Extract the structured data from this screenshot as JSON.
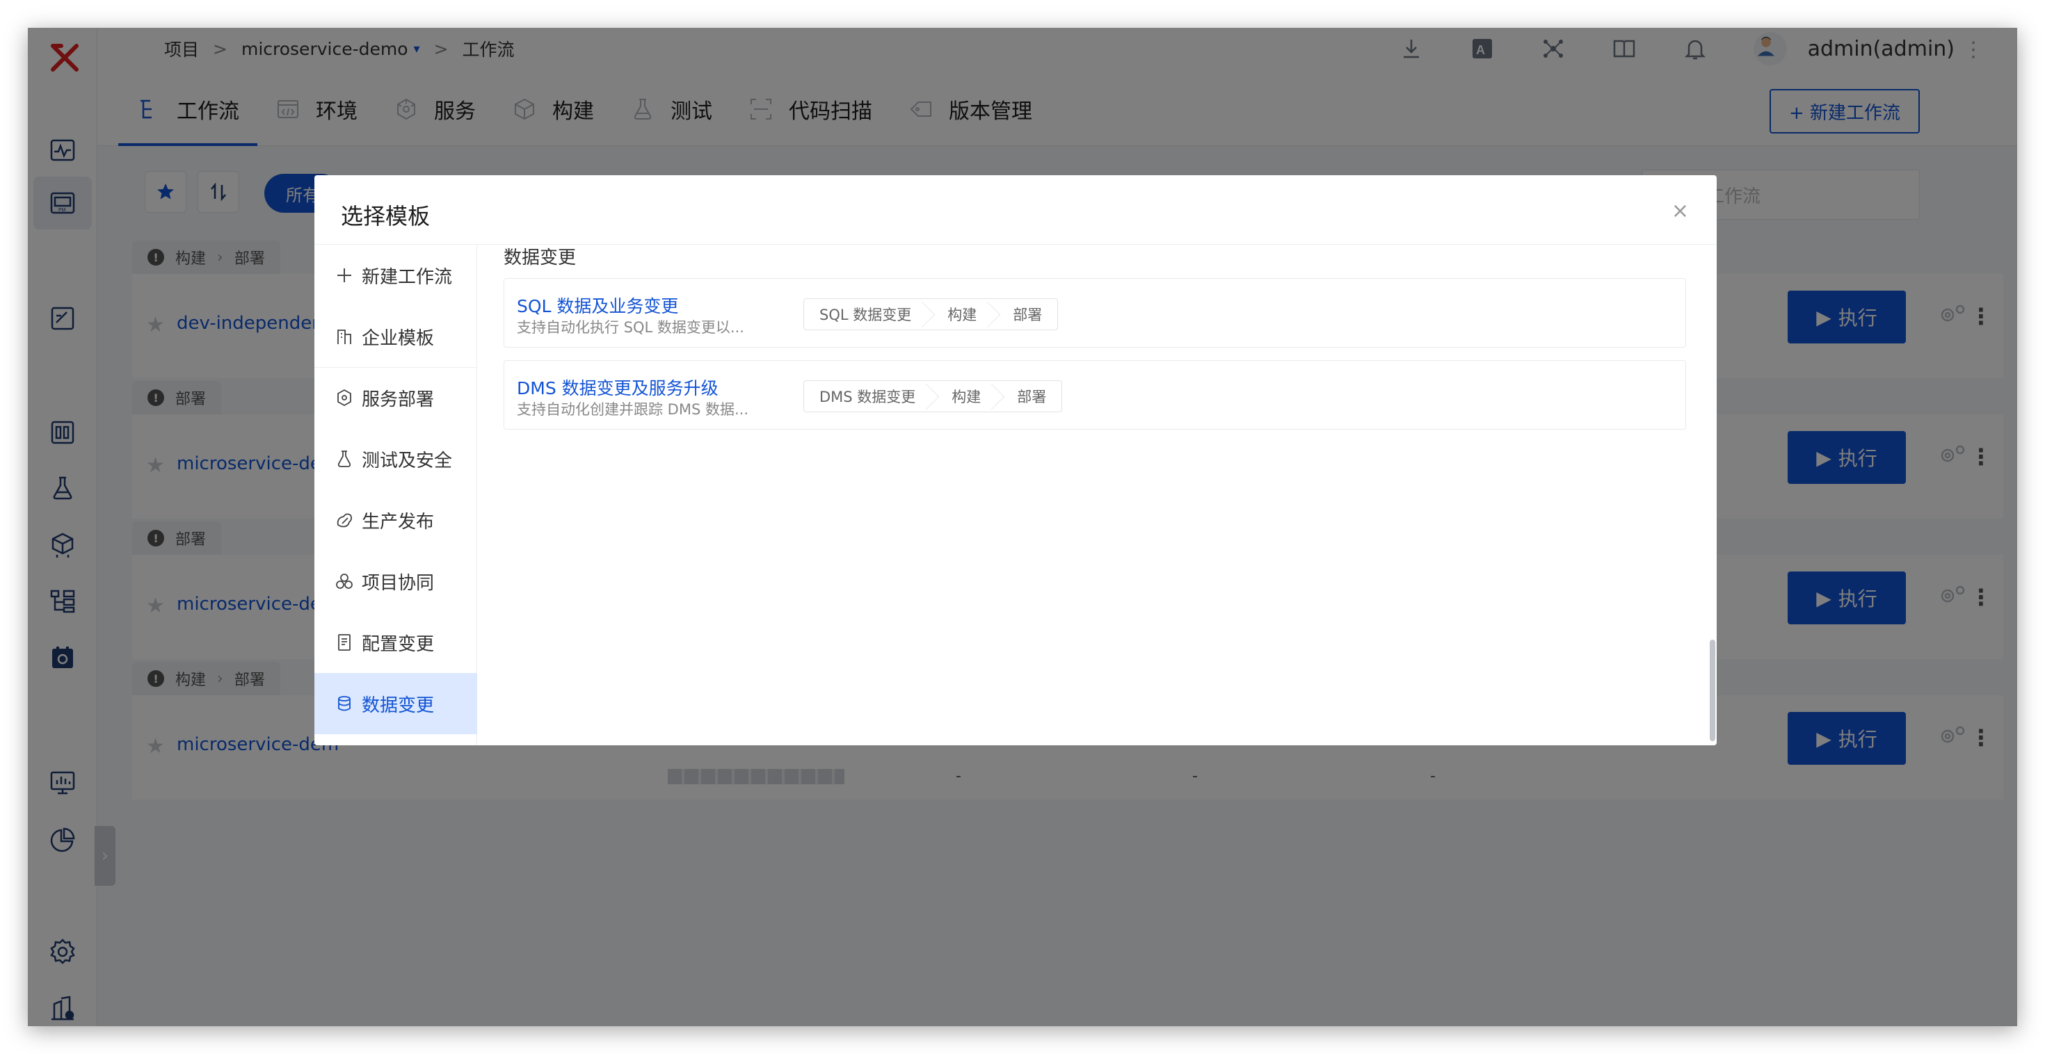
{
  "header": {
    "breadcrumb": {
      "root": "项目",
      "sep1": ">",
      "project": "microservice-demo",
      "caret": "▾",
      "sep2": ">",
      "page": "工作流"
    },
    "icons": [
      "download-icon",
      "translate-icon",
      "network-icon",
      "docs-icon",
      "bell-icon"
    ],
    "user": {
      "name": "admin(admin)"
    },
    "more": "⋮"
  },
  "tabs": [
    {
      "label": "工作流",
      "icon": "workflow-icon"
    },
    {
      "label": "环境",
      "icon": "environment-icon"
    },
    {
      "label": "服务",
      "icon": "service-icon"
    },
    {
      "label": "构建",
      "icon": "build-icon"
    },
    {
      "label": "测试",
      "icon": "test-icon"
    },
    {
      "label": "代码扫描",
      "icon": "scan-icon"
    },
    {
      "label": "版本管理",
      "icon": "version-icon"
    }
  ],
  "actions": {
    "new_workflow": "+ 新建工作流"
  },
  "filters": {
    "all": "所有",
    "search_placeholder": "搜索工作流"
  },
  "workflows": [
    {
      "tags": [
        "构建",
        "部署"
      ],
      "name": "dev-independent-",
      "exec": "执行"
    },
    {
      "tags": [
        "部署"
      ],
      "name": "microservice-dem",
      "exec": "执行"
    },
    {
      "tags": [
        "部署"
      ],
      "name": "microservice-dem",
      "exec": "执行"
    },
    {
      "tags": [
        "构建",
        "部署"
      ],
      "name": "microservice-dem",
      "exec": "执行",
      "cells": [
        "-",
        "-",
        "-"
      ]
    }
  ],
  "modal": {
    "title": "选择模板",
    "close": "×",
    "nav": [
      {
        "label": "新建工作流",
        "icon": "plus-icon"
      },
      {
        "label": "企业模板",
        "icon": "enterprise-icon"
      },
      {
        "label": "服务部署",
        "icon": "deploy-icon"
      },
      {
        "label": "测试及安全",
        "icon": "security-icon"
      },
      {
        "label": "生产发布",
        "icon": "release-icon"
      },
      {
        "label": "项目协同",
        "icon": "collab-icon"
      },
      {
        "label": "配置变更",
        "icon": "config-icon"
      },
      {
        "label": "数据变更",
        "icon": "database-icon"
      }
    ],
    "section_title": "数据变更",
    "templates": [
      {
        "name": "SQL 数据及业务变更",
        "desc": "支持自动化执行 SQL 数据变更以...",
        "stages": [
          "SQL 数据变更",
          "构建",
          "部署"
        ]
      },
      {
        "name": "DMS 数据变更及服务升级",
        "desc": "支持自动化创建并跟踪 DMS 数据...",
        "stages": [
          "DMS 数据变更",
          "构建",
          "部署"
        ]
      }
    ]
  },
  "colors": {
    "primary": "#1354d4",
    "overlay": "rgba(0,0,0,0.5)",
    "logo": "#e02020"
  }
}
